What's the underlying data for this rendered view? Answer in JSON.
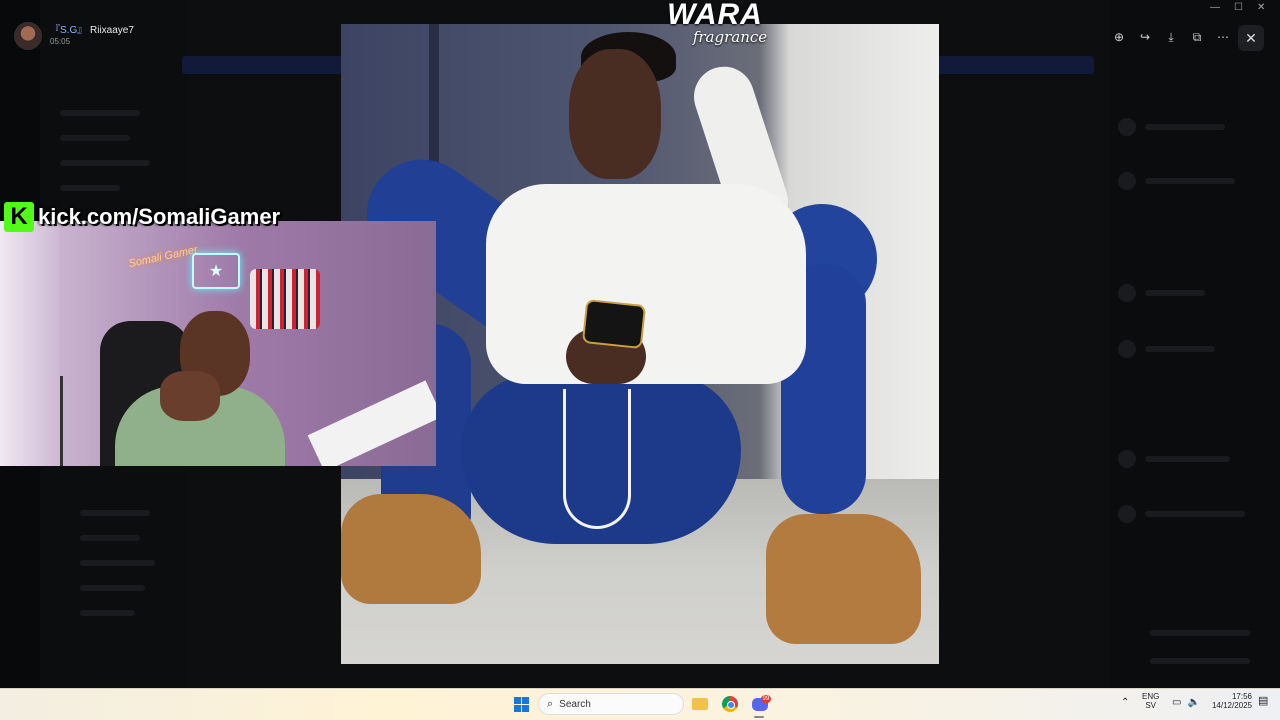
{
  "viewer": {
    "user_tag": "『S.G』",
    "user_name": "Riixaaye7",
    "time": "05:05",
    "toolbar": {
      "zoom_icon": "zoom-in-icon",
      "forward_icon": "forward-icon",
      "download_icon": "download-icon",
      "open_icon": "open-external-icon",
      "more_icon": "more-icon",
      "close_icon": "close-icon"
    }
  },
  "watermark": {
    "main": "WARA",
    "sub": "fragrance"
  },
  "stream_overlay": {
    "link_text": "kick.com/SomaliGamer",
    "logo_letter": "K",
    "neon_text": "Somali Gamer",
    "neon_flag_symbol": "★"
  },
  "taskbar": {
    "search_placeholder": "Search",
    "discord_badge": "99",
    "lang_top": "ENG",
    "lang_bottom": "SV",
    "time": "17:56",
    "date": "14/12/2025"
  },
  "colors": {
    "kick_green": "#53fc18",
    "discord_blurple": "#5865f2",
    "windows_blue": "#1a73e8"
  }
}
